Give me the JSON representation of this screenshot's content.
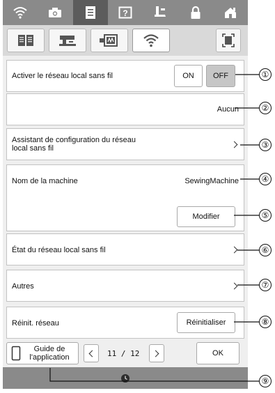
{
  "wireless_row": {
    "label": "Activer le réseau local sans fil",
    "on": "ON",
    "off": "OFF",
    "selected": "OFF"
  },
  "network_row": {
    "value": "Aucun"
  },
  "wizard_row": {
    "label_line1": "Assistant de configuration du réseau",
    "label_line2": "local sans fil"
  },
  "machine_row": {
    "label": "Nom de la machine",
    "value": "SewingMachine",
    "modify": "Modifier"
  },
  "status_row": {
    "label": "État du réseau local sans fil"
  },
  "others_row": {
    "label": "Autres"
  },
  "reset_row": {
    "label": "Réinit. réseau",
    "button": "Réinitialiser"
  },
  "footer": {
    "guide_line1": "Guide de",
    "guide_line2": "l'application",
    "page": "11 / 12",
    "ok": "OK"
  },
  "callouts": [
    "①",
    "②",
    "③",
    "④",
    "⑤",
    "⑥",
    "⑦",
    "⑧",
    "⑨"
  ],
  "icons": {
    "top": [
      "wifi-icon",
      "camera-icon",
      "settings-page-icon",
      "help-icon",
      "presser-foot-icon",
      "lock-icon",
      "home-icon"
    ],
    "tabs": [
      "book-icon",
      "sewing-machine-icon",
      "embroidery-icon",
      "wifi-icon",
      "screenshot-icon"
    ]
  },
  "colors": {
    "topbar": "#8a8a8a",
    "active": "#5c5c5c",
    "panel": "#ffffff"
  }
}
